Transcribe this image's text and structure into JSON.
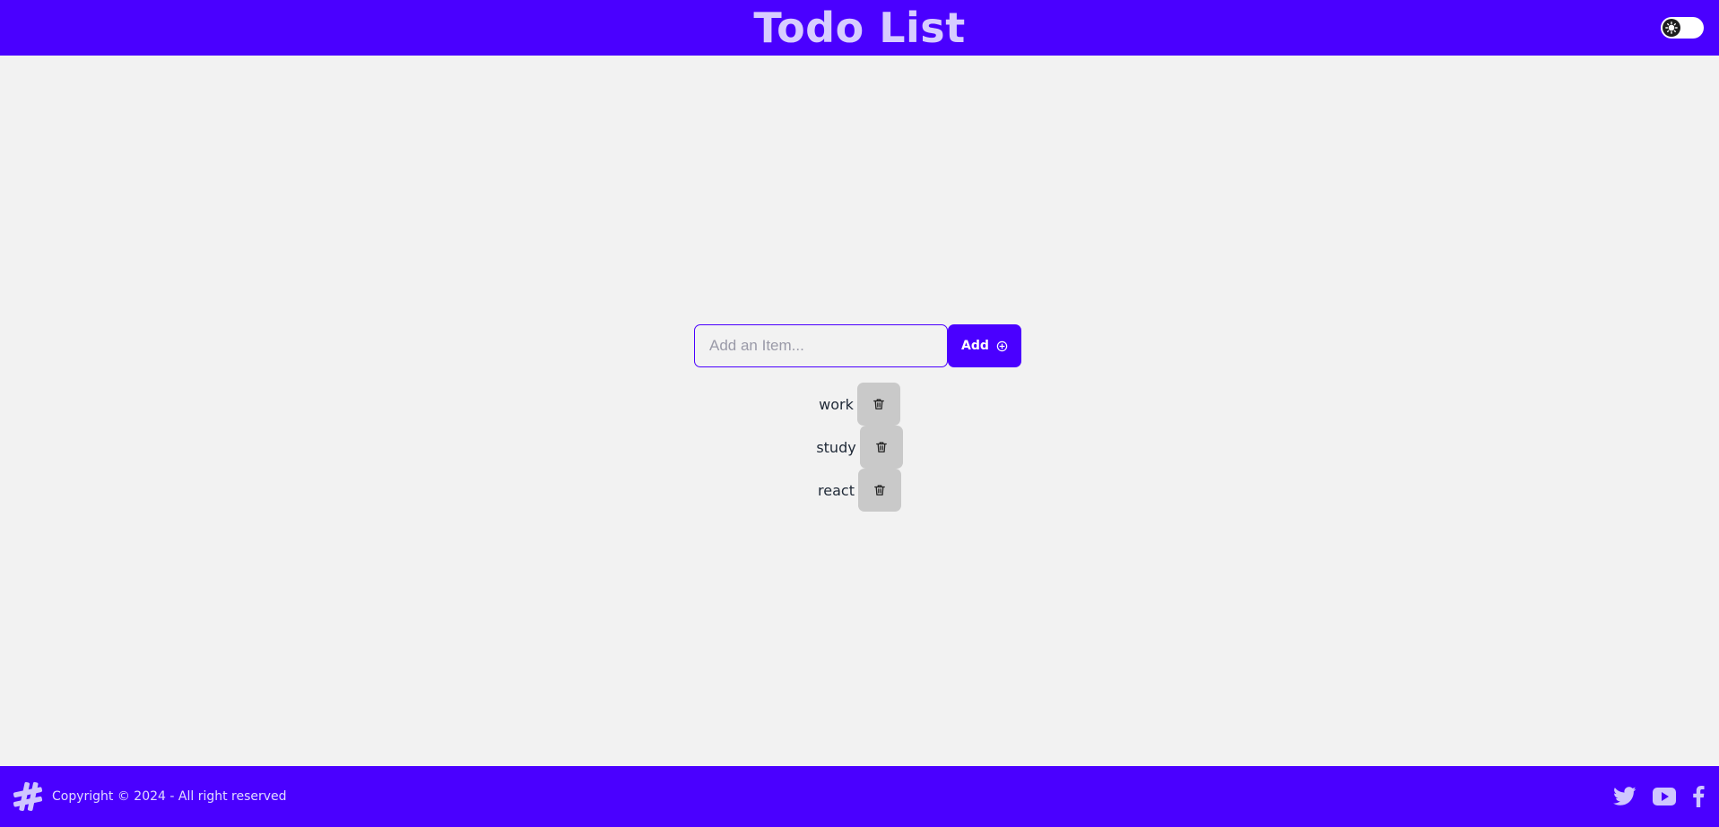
{
  "header": {
    "title": "Todo List",
    "theme_toggle_icon": "sun-icon"
  },
  "form": {
    "placeholder": "Add an Item...",
    "value": "",
    "add_label": "Add",
    "add_icon": "plus-circle-icon"
  },
  "items": [
    {
      "text": "work",
      "delete_icon": "trash-icon"
    },
    {
      "text": "study",
      "delete_icon": "trash-icon"
    },
    {
      "text": "react",
      "delete_icon": "trash-icon"
    }
  ],
  "footer": {
    "logo_icon": "hashtag-icon",
    "copyright": "Copyright © 2024 - All right reserved",
    "socials": [
      "twitter-icon",
      "youtube-icon",
      "facebook-icon"
    ]
  },
  "colors": {
    "primary": "#4a00ff",
    "background": "#f2f2f2",
    "title": "#d7ccff",
    "delete_button": "#c9c9c9"
  }
}
